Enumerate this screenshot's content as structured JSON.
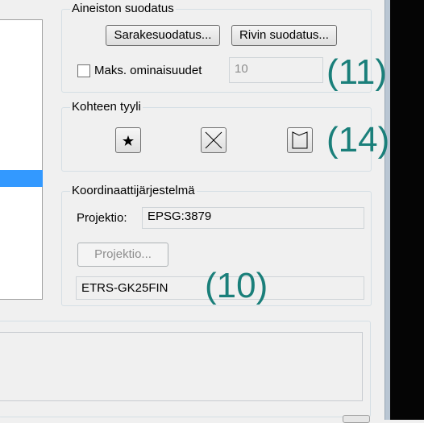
{
  "filter_group": {
    "legend": "Aineiston suodatus",
    "column_filter_button": "Sarakesuodatus...",
    "row_filter_button": "Rivin suodatus...",
    "max_features_label": "Maks. ominaisuudet",
    "max_features_checked": false,
    "max_features_value": "10"
  },
  "style_group": {
    "legend": "Kohteen tyyli",
    "buttons": [
      {
        "icon": "star-icon"
      },
      {
        "icon": "x-cross-icon"
      },
      {
        "icon": "polygon-outline-icon"
      }
    ]
  },
  "crs_group": {
    "legend": "Koordinaattijärjestelmä",
    "projection_label": "Projektio:",
    "projection_value": "EPSG:3879",
    "projection_button": "Projektio...",
    "crs_name": "ETRS-GK25FIN"
  },
  "callouts": {
    "filter": "(11)",
    "style": "(14)",
    "crs": "(10)"
  },
  "colors": {
    "callout": "#1a7f7a",
    "selection": "#3399ff"
  }
}
